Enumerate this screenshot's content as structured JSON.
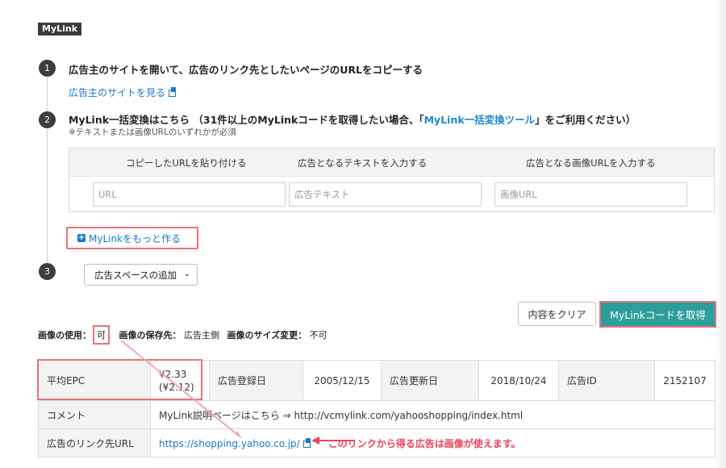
{
  "tag": "MyLink",
  "steps": {
    "step1": {
      "num": "1",
      "title": "広告主のサイトを開いて、広告のリンク先としたいページのURLをコピーする",
      "link": "広告主のサイトを見る"
    },
    "step2": {
      "num": "2",
      "title_pre": "MyLink一括変換はこちら （31件以上のMyLinkコードを取得したい場合、「",
      "title_link": "MyLink一括変換ツール",
      "title_post": "」をご利用ください）",
      "note": "※テキストまたは画像URLのいずれかが必須"
    },
    "step3": {
      "num": "3"
    }
  },
  "inputs": {
    "col1_header": "コピーしたURLを貼り付ける",
    "col2_header": "広告となるテキストを入力する",
    "col3_header": "広告となる画像URLを入力する",
    "url_placeholder": "URL",
    "text_placeholder": "広告テキスト",
    "image_placeholder": "画像URL"
  },
  "more_button": "MyLinkをもっと作る",
  "ad_space_select": "広告スペースの追加",
  "clear_button": "内容をクリア",
  "get_code_button": "MyLinkコードを取得",
  "usage": {
    "image_use_label": "画像の使用：",
    "image_use_value": "可",
    "storage_label": "画像の保存先：",
    "storage_value": "広告主側",
    "resize_label": "画像のサイズ変更：",
    "resize_value": "不可"
  },
  "info_table": {
    "avg_epc_label": "平均EPC",
    "avg_epc_value": "¥2.33",
    "avg_epc_sub": "(¥2.12)",
    "reg_date_label": "広告登録日",
    "reg_date_value": "2005/12/15",
    "upd_date_label": "広告更新日",
    "upd_date_value": "2018/10/24",
    "ad_id_label": "広告ID",
    "ad_id_value": "2152107",
    "comment_label": "コメント",
    "comment_value": "MyLink説明ページはこちら ⇒ http://vcmylink.com/yahooshopping/index.html",
    "link_url_label": "広告のリンク先URL",
    "link_url_value": "https://shopping.yahoo.co.jp/",
    "annotation": "このリンクから得る広告は画像が使えます。"
  },
  "colors": {
    "accent_teal": "#2c9e9b",
    "highlight_red": "#e9727a",
    "link_blue": "#1a77c9",
    "annotation_red": "#e8455a"
  }
}
